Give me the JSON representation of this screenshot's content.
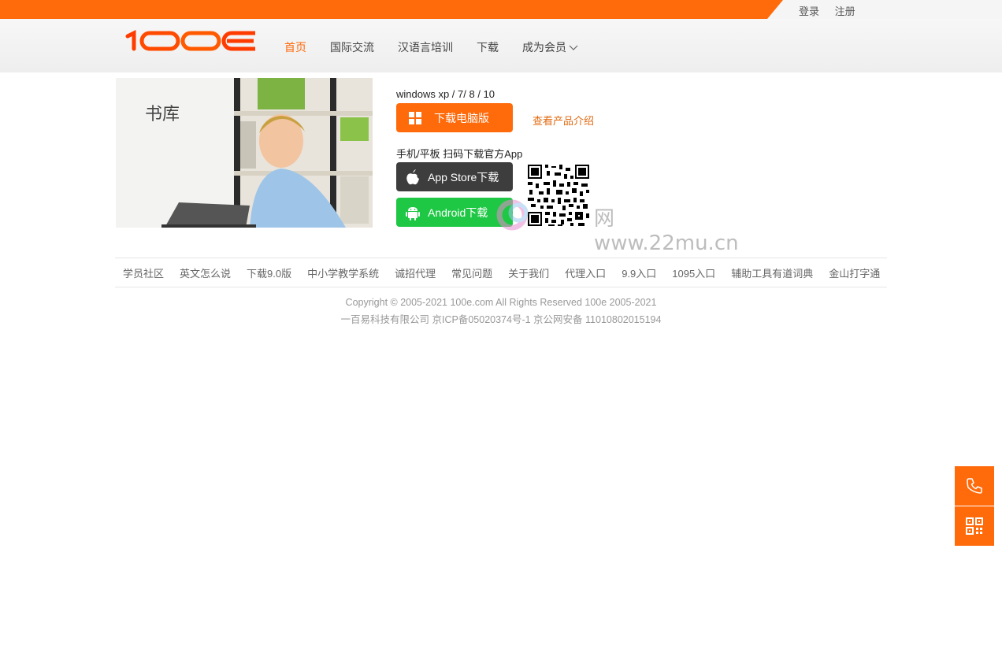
{
  "top_links": [
    "登录",
    "注册"
  ],
  "logo": {
    "text": "100e",
    "color": "#ff4a00"
  },
  "nav": [
    {
      "label": "首页",
      "active": true
    },
    {
      "label": "国际交流",
      "active": false
    },
    {
      "label": "汉语言培训",
      "active": false
    },
    {
      "label": "下载",
      "active": false
    },
    {
      "label": "成为会员",
      "active": false,
      "dropdown": true
    }
  ],
  "hero": {
    "title": "书库"
  },
  "download": {
    "os_label": "windows xp / 7/ 8 / 10",
    "pc_button": "下载电脑版",
    "product_link": "查看产品介绍",
    "mobile_label": "手机/平板 扫码下载官方App",
    "ios_button": "App Store下载",
    "android_button": "Android下载"
  },
  "watermark": {
    "text": "网 www.22mu.cn"
  },
  "footer_links": [
    "学员社区",
    "英文怎么说",
    "下载9.0版",
    "中小学教学系统",
    "诚招代理",
    "常见问题",
    "关于我们",
    "代理入口",
    "9.9入口",
    "1095入口",
    "辅助工具有道词典",
    "金山打字通"
  ],
  "copyright": {
    "line1": "Copyright © 2005-2021 100e.com All Rights Reserved 100e 2005-2021",
    "line2": "一百易科技有限公司 京ICP备05020374号-1 京公网安备 11010802015194"
  },
  "colors": {
    "accent": "#ff6a0b",
    "android": "#1ec744",
    "ios": "#3d3d3d"
  },
  "side": {
    "phone": "phone-icon",
    "qr": "qrcode-icon"
  }
}
